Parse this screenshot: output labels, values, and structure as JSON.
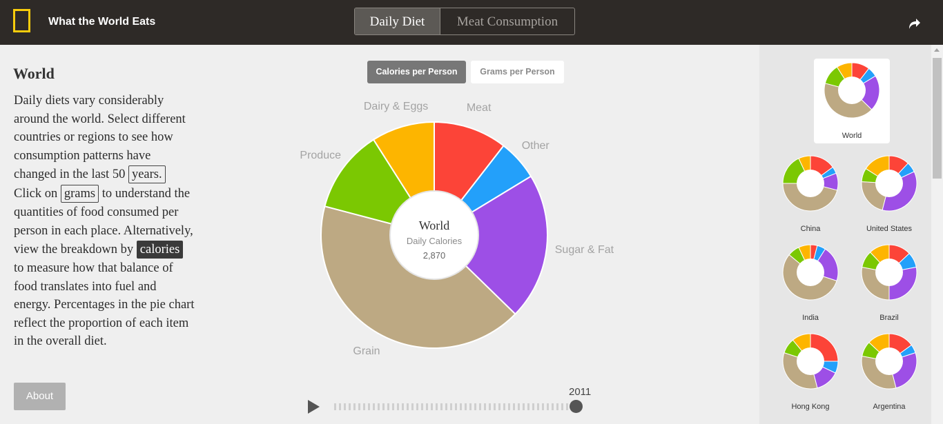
{
  "header": {
    "app_title": "What the World Eats",
    "tabs": [
      {
        "label": "Daily Diet",
        "active": true
      },
      {
        "label": "Meat Consumption",
        "active": false
      }
    ],
    "share_icon": "share-arrow-icon",
    "logo_color": "#f8cc0c"
  },
  "info": {
    "region_title": "World",
    "paragraph": {
      "p1": "Daily diets vary considerably around the world. Select different countries or regions to see how consumption patterns have changed in the last 50 ",
      "chip_years": "years.",
      "p2": " Click on ",
      "chip_grams": "grams",
      "p3": " to understand the quantities of food consumed per person in each place. Alternatively, view the breakdown by ",
      "chip_calories": "calories",
      "p4": " to measure how that balance of food translates into fuel and energy. Percentages in the pie chart reflect the proportion of each item in the overall diet."
    },
    "about_label": "About"
  },
  "measure_tabs": {
    "calories": "Calories per Person",
    "grams": "Grams per Person",
    "selected": "calories"
  },
  "center": {
    "title": "World",
    "subtitle": "Daily Calories",
    "value": "2,870"
  },
  "timeline": {
    "year": "2011",
    "progress": 0.98
  },
  "chart_data": {
    "type": "pie",
    "title": "World",
    "categories": [
      "Meat",
      "Other",
      "Sugar & Fat",
      "Grain",
      "Produce",
      "Dairy & Eggs"
    ],
    "values": [
      10.5,
      5.8,
      21.0,
      41.8,
      11.9,
      9.0
    ],
    "colors": [
      "#fc4438",
      "#23a0fa",
      "#9d4fe6",
      "#bda983",
      "#7bc802",
      "#fdb500"
    ]
  },
  "sidebar": {
    "cards": [
      {
        "label": "World",
        "selected": true,
        "values": [
          10.5,
          5.8,
          21.0,
          41.8,
          11.9,
          9.0
        ]
      },
      {
        "label": "China",
        "selected": false,
        "values": [
          15,
          4,
          10,
          46,
          18,
          7
        ]
      },
      {
        "label": "United States",
        "selected": false,
        "values": [
          12,
          6,
          36,
          22,
          8,
          16
        ]
      },
      {
        "label": "India",
        "selected": false,
        "values": [
          4,
          5,
          21,
          56,
          7,
          7
        ]
      },
      {
        "label": "Brazil",
        "selected": false,
        "values": [
          13,
          9,
          28,
          28,
          10,
          12
        ]
      },
      {
        "label": "Hong Kong",
        "selected": false,
        "values": [
          25,
          7,
          14,
          34,
          9,
          11
        ]
      },
      {
        "label": "Argentina",
        "selected": false,
        "values": [
          15,
          5,
          26,
          32,
          9,
          13
        ]
      }
    ]
  }
}
